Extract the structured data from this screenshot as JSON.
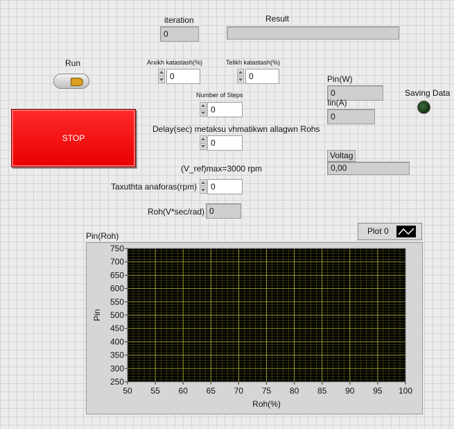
{
  "iteration": {
    "label": "iteration",
    "value": "0"
  },
  "result": {
    "label": "Result",
    "value": ""
  },
  "run": {
    "label": "Run"
  },
  "stop": {
    "label": "STOP"
  },
  "arxikh": {
    "label": "Arxikh katastash(%)",
    "value": "0"
  },
  "telikh": {
    "label": "Telikh katastash(%)",
    "value": "0"
  },
  "steps": {
    "label": "Number of Steps",
    "value": "0"
  },
  "delay": {
    "label": "Delay(sec) metaksu vhmatikwn allagwn Rohs",
    "value": "0"
  },
  "vref": {
    "label": "(V_ref)max=3000 rpm"
  },
  "taxuthta": {
    "label": "Taxuthta anaforas(rpm)",
    "value": "0"
  },
  "roh": {
    "label": "Roh(V*sec/rad)",
    "value": "0"
  },
  "pin": {
    "label": "Pin(W)",
    "value": "0"
  },
  "iin": {
    "label": "Iin(A)",
    "value": "0"
  },
  "saving": {
    "label": "Saving Data"
  },
  "voltag": {
    "label": "Voltag",
    "value": "0,00"
  },
  "graph": {
    "title": "Pin(Roh)",
    "legend": "Plot 0"
  },
  "colors": {
    "plot_bg": "#000000",
    "grid": "#b9b936",
    "stop": "#ff1a1a",
    "led_off": "#1f4a1f"
  },
  "chart_data": {
    "type": "line",
    "title": "Pin(Roh)",
    "xlabel": "Roh(%)",
    "ylabel": "Pin",
    "xlim": [
      50,
      100
    ],
    "ylim": [
      250,
      750
    ],
    "xticks": [
      "50",
      "55",
      "60",
      "65",
      "70",
      "75",
      "80",
      "85",
      "90",
      "95",
      "100"
    ],
    "yticks": [
      "250",
      "300",
      "350",
      "400",
      "450",
      "500",
      "550",
      "600",
      "650",
      "700",
      "750"
    ],
    "grid": true,
    "series": [
      {
        "name": "Plot 0",
        "x": [],
        "y": []
      }
    ]
  }
}
